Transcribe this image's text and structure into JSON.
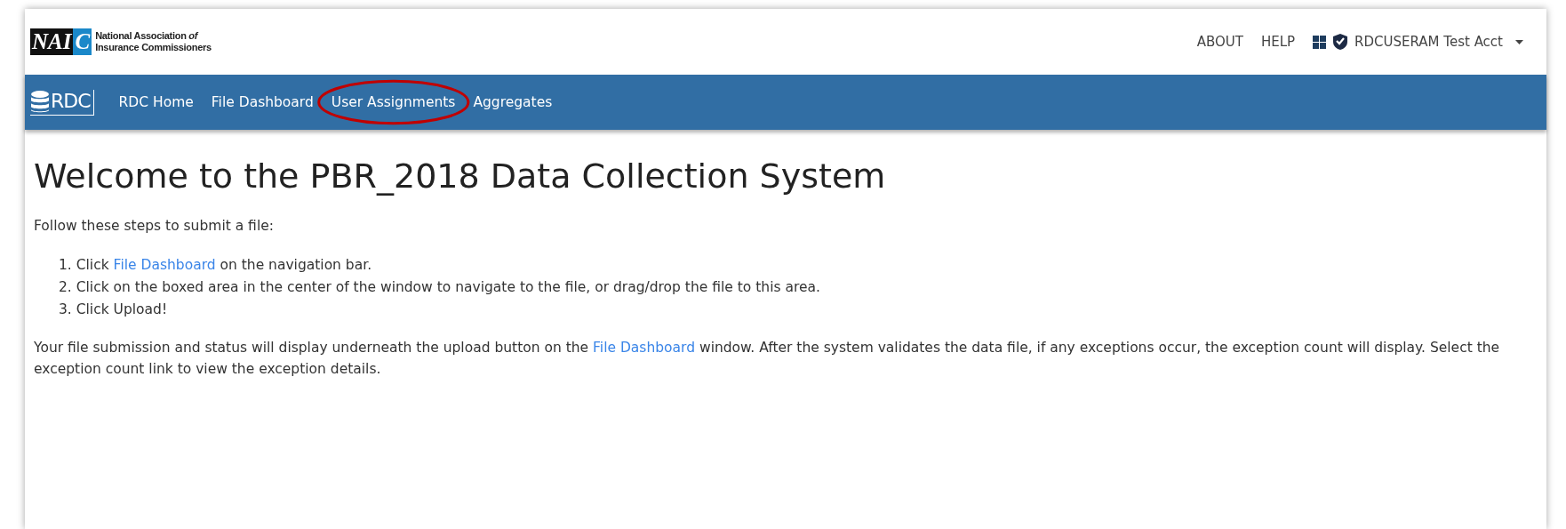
{
  "header": {
    "logo": {
      "mark_dark": "NAI",
      "mark_light": "C",
      "lines": [
        "National Association *of*",
        "Insurance Commissioners"
      ]
    },
    "links": [
      "ABOUT",
      "HELP"
    ],
    "user": {
      "name": "RDCUSERAM Test Acct"
    }
  },
  "navbar": {
    "brand": "RDC",
    "items": [
      {
        "label": "RDC Home",
        "highlighted": false
      },
      {
        "label": "File Dashboard",
        "highlighted": false
      },
      {
        "label": "User Assignments",
        "highlighted": true
      },
      {
        "label": "Aggregates",
        "highlighted": false
      }
    ]
  },
  "content": {
    "title": "Welcome to the PBR_2018 Data Collection System",
    "intro": "Follow these steps to submit a file:",
    "steps": [
      {
        "number": "1.",
        "before": "Click ",
        "link": "File Dashboard",
        "after": " on the navigation bar."
      },
      {
        "number": "2.",
        "before": "Click on the boxed area in the center of the window to navigate to the file, or drag/drop the file to this area."
      },
      {
        "number": "3.",
        "before": "Click Upload!"
      }
    ],
    "note": {
      "before": "Your file submission and status will display underneath the upload button on the ",
      "link": "File Dashboard",
      "after": " window. After the system validates the data file, if any exceptions occur, the exception count will display. Select the exception count link to view the exception details."
    }
  }
}
